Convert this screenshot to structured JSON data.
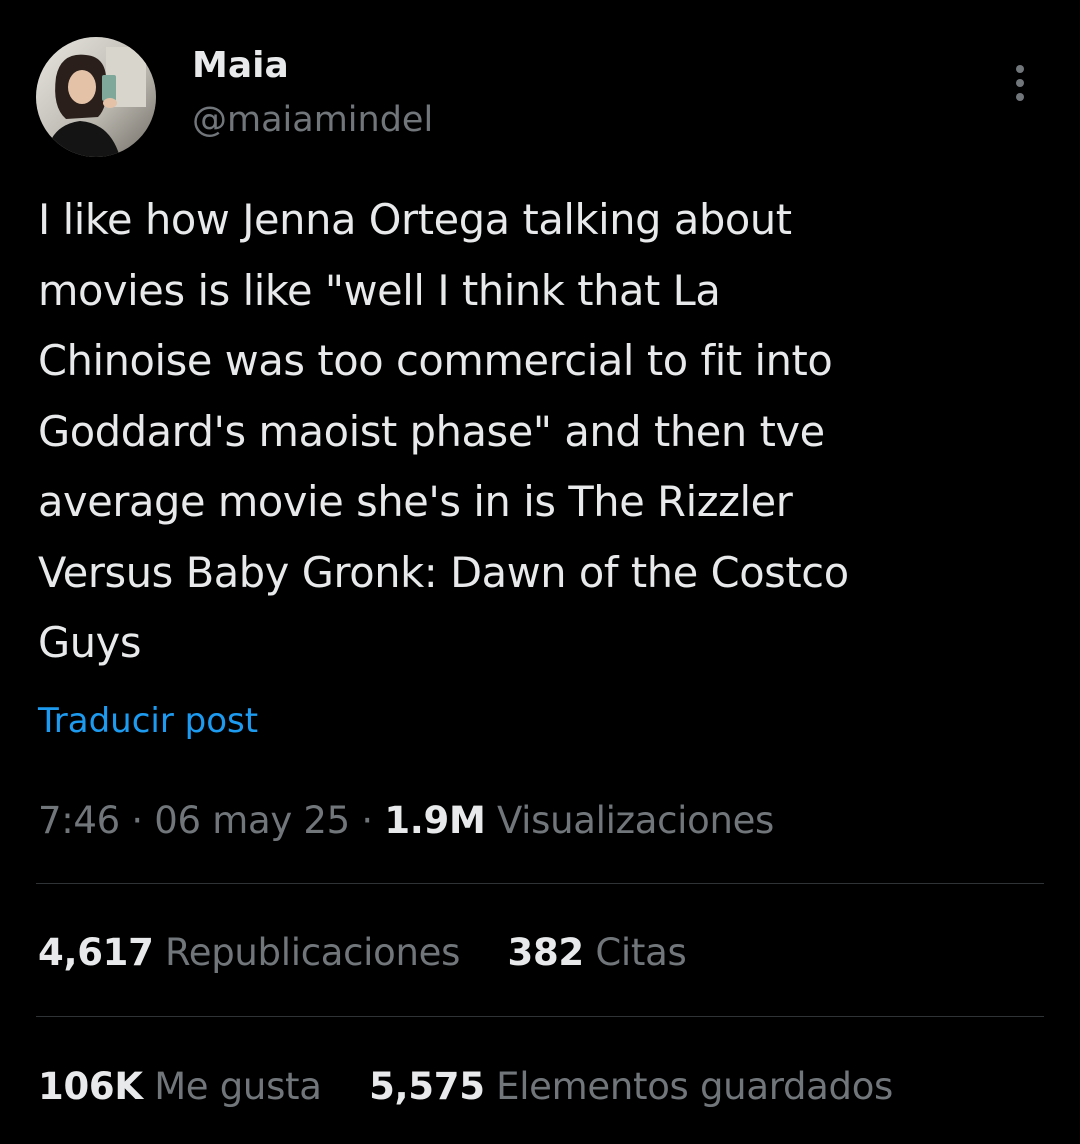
{
  "author": {
    "display_name": "Maia",
    "handle": "@maiamindel",
    "avatar_icon": "profile-photo"
  },
  "menu": {
    "more_icon": "ellipsis-vertical-icon"
  },
  "tweet": {
    "text": "I like how Jenna Ortega talking about\nmovies is like \"well I think that La\nChinoise was too commercial to fit into\nGoddard's maoist phase\" and then tve\naverage movie she's in is The Rizzler\nVersus Baby Gronk: Dawn of the Costco\nGuys",
    "translate_label": "Traducir post"
  },
  "meta": {
    "time": "7:46",
    "separator": "·",
    "date": "06 may 25",
    "views_count": "1.9M",
    "views_label": "Visualizaciones"
  },
  "stats": {
    "reposts_count": "4,617",
    "reposts_label": "Republicaciones",
    "quotes_count": "382",
    "quotes_label": "Citas",
    "likes_count": "106K",
    "likes_label": "Me gusta",
    "bookmarks_count": "5,575",
    "bookmarks_label": "Elementos guardados"
  },
  "colors": {
    "background": "#000000",
    "primary_text": "#e7e9ea",
    "secondary_text": "#71767b",
    "link": "#1d9bf0",
    "divider": "#2f3336"
  }
}
